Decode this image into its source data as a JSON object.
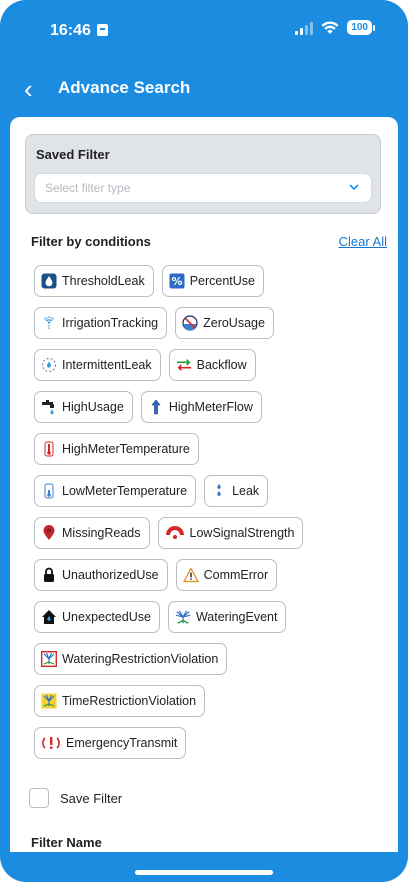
{
  "status_bar": {
    "time": "16:46",
    "battery": "100"
  },
  "header": {
    "title": "Advance Search"
  },
  "saved_filter": {
    "title": "Saved Filter",
    "placeholder": "Select filter type"
  },
  "conditions": {
    "title": "Filter by conditions",
    "clear_label": "Clear All",
    "rows": [
      [
        {
          "label": "ThresholdLeak",
          "icon": "threshold-leak-icon"
        },
        {
          "label": "PercentUse",
          "icon": "percent-use-icon"
        }
      ],
      [
        {
          "label": "IrrigationTracking",
          "icon": "irrigation-tracking-icon"
        },
        {
          "label": "ZeroUsage",
          "icon": "zero-usage-icon"
        }
      ],
      [
        {
          "label": "IntermittentLeak",
          "icon": "intermittent-leak-icon"
        },
        {
          "label": "Backflow",
          "icon": "backflow-icon"
        }
      ],
      [
        {
          "label": "HighUsage",
          "icon": "high-usage-icon"
        },
        {
          "label": "HighMeterFlow",
          "icon": "high-meter-flow-icon"
        }
      ],
      [
        {
          "label": "HighMeterTemperature",
          "icon": "high-temperature-icon"
        }
      ],
      [
        {
          "label": "LowMeterTemperature",
          "icon": "low-temperature-icon"
        },
        {
          "label": "Leak",
          "icon": "leak-icon"
        }
      ],
      [
        {
          "label": "MissingReads",
          "icon": "missing-reads-icon"
        },
        {
          "label": "LowSignalStrength",
          "icon": "low-signal-icon"
        }
      ],
      [
        {
          "label": "UnauthorizedUse",
          "icon": "lock-icon"
        },
        {
          "label": "CommError",
          "icon": "warning-icon"
        }
      ],
      [
        {
          "label": "UnexpectedUse",
          "icon": "house-icon"
        },
        {
          "label": "WateringEvent",
          "icon": "sprinkler-icon"
        }
      ],
      [
        {
          "label": "WateringRestrictionViolation",
          "icon": "watering-restriction-icon"
        }
      ],
      [
        {
          "label": "TimeRestrictionViolation",
          "icon": "time-restriction-icon"
        }
      ],
      [
        {
          "label": "EmergencyTransmit",
          "icon": "emergency-icon"
        }
      ]
    ]
  },
  "save_filter": {
    "label": "Save Filter",
    "checked": false
  },
  "filter_name": {
    "title": "Filter Name"
  },
  "colors": {
    "primary": "#1c8ce0",
    "link": "#1877d0",
    "panel": "#e0e3e8"
  }
}
